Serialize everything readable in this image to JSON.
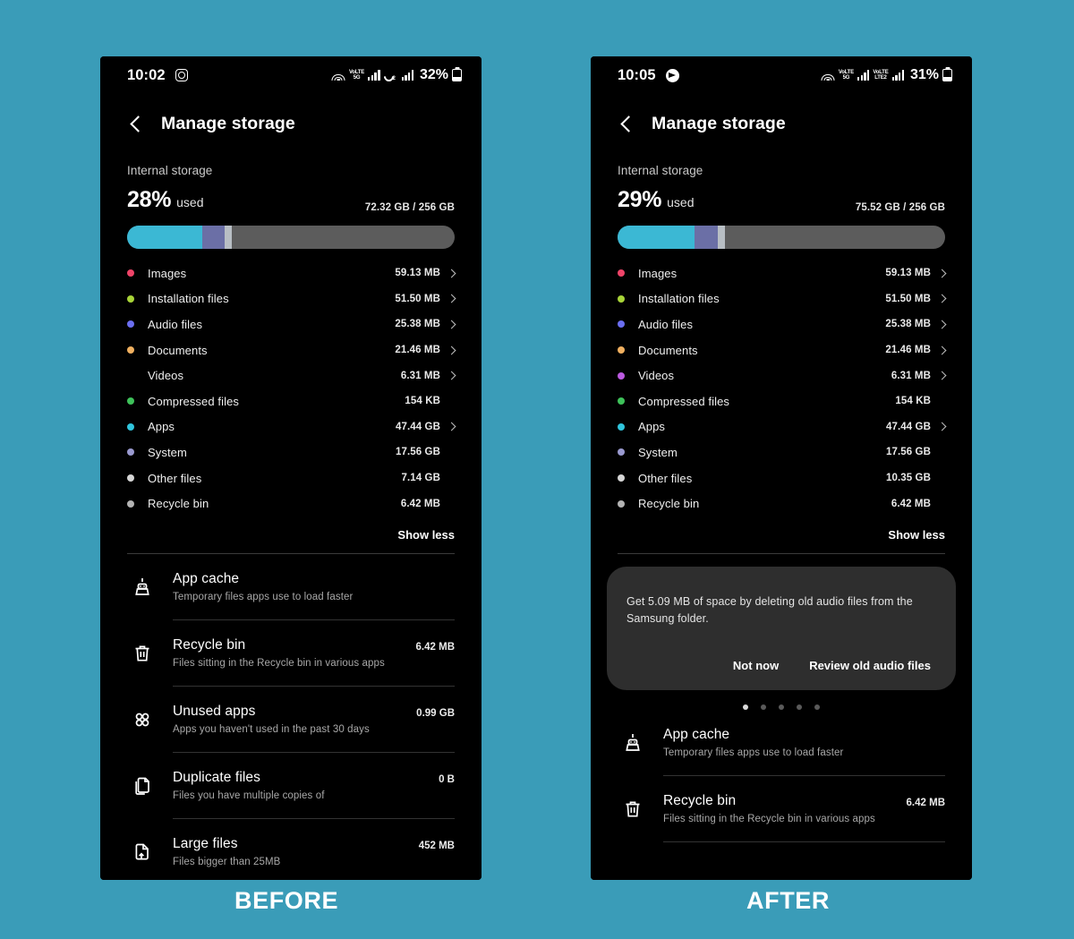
{
  "background_color": "#3a9cb8",
  "captions": {
    "before": "BEFORE",
    "after": "AFTER"
  },
  "before": {
    "status_bar": {
      "time": "10:02",
      "app_icon": "instagram-icon",
      "wifi_icon": "wifi-icon",
      "network1_label_top": "VoLTE",
      "network1_label_bottom": "5G",
      "signal1_icon": "signal-bars-icon",
      "call_icon": "call-forwarding-icon",
      "call_badge": "2",
      "signal2_icon": "signal-bars-icon",
      "battery_percent": "32%",
      "battery_icon": "battery-icon"
    },
    "app_bar": {
      "back_icon": "back-chevron-icon",
      "title": "Manage storage"
    },
    "summary": {
      "label": "Internal storage",
      "percent": "28%",
      "used_word": "used",
      "capacity": "72.32 GB / 256 GB",
      "bar_segments": [
        {
          "name": "apps",
          "color": "#3bb8d4",
          "width_pct": 23.0
        },
        {
          "name": "system",
          "color": "#6b6fa6",
          "width_pct": 6.8
        },
        {
          "name": "other",
          "color": "#b8bec4",
          "width_pct": 2.2
        }
      ],
      "track_color": "#5c5c5c"
    },
    "categories": [
      {
        "name": "Images",
        "size": "59.13 MB",
        "color": "#ef4468",
        "chevron": true
      },
      {
        "name": "Installation files",
        "size": "51.50 MB",
        "color": "#a8d438",
        "chevron": true
      },
      {
        "name": "Audio files",
        "size": "25.38 MB",
        "color": "#6b6ef0",
        "chevron": true
      },
      {
        "name": "Documents",
        "size": "21.46 MB",
        "color": "#f0b060",
        "chevron": true
      },
      {
        "name": "Videos",
        "size": "6.31 MB",
        "color": "#b martin",
        "chevron": true
      },
      {
        "name": "Compressed files",
        "size": "154 KB",
        "color": "#3ec25a",
        "chevron": false
      },
      {
        "name": "Apps",
        "size": "47.44 GB",
        "color": "#30c5dd",
        "chevron": true
      },
      {
        "name": "System",
        "size": "17.56 GB",
        "color": "#9a9ad0",
        "chevron": false
      },
      {
        "name": "Other files",
        "size": "7.14 GB",
        "color": "#d6d6d6",
        "chevron": false
      },
      {
        "name": "Recycle bin",
        "size": "6.42 MB",
        "color": "#b4b4b4",
        "chevron": false
      }
    ],
    "show_less": "Show less",
    "options": [
      {
        "icon": "broom-icon",
        "title": "App cache",
        "subtitle": "Temporary files apps use to load faster",
        "size": ""
      },
      {
        "icon": "trash-icon",
        "title": "Recycle bin",
        "subtitle": "Files sitting in the Recycle bin in various apps",
        "size": "6.42 MB"
      },
      {
        "icon": "four-dots-icon",
        "title": "Unused apps",
        "subtitle": "Apps you haven't used in the past 30 days",
        "size": "0.99 GB"
      },
      {
        "icon": "duplicate-files-icon",
        "title": "Duplicate files",
        "subtitle": "Files you have multiple copies of",
        "size": "0 B"
      },
      {
        "icon": "large-file-icon",
        "title": "Large files",
        "subtitle": "Files bigger than 25MB",
        "size": "452 MB"
      }
    ]
  },
  "after": {
    "status_bar": {
      "time": "10:05",
      "app_icon": "telegram-icon",
      "wifi_icon": "wifi-icon",
      "network1_label_top": "VoLTE",
      "network1_label_bottom": "5G",
      "signal1_icon": "signal-bars-icon",
      "network2_label_top": "VoLTE",
      "network2_label_bottom": "LTE2",
      "signal2_icon": "signal-bars-icon",
      "battery_percent": "31%",
      "battery_icon": "battery-icon"
    },
    "app_bar": {
      "back_icon": "back-chevron-icon",
      "title": "Manage storage"
    },
    "summary": {
      "label": "Internal storage",
      "percent": "29%",
      "used_word": "used",
      "capacity": "75.52 GB / 256 GB",
      "bar_segments": [
        {
          "name": "apps",
          "color": "#3bb8d4",
          "width_pct": 23.5
        },
        {
          "name": "system",
          "color": "#6b6fa6",
          "width_pct": 7.0
        },
        {
          "name": "other",
          "color": "#b8bec4",
          "width_pct": 2.4
        }
      ],
      "track_color": "#5c5c5c"
    },
    "categories": [
      {
        "name": "Images",
        "size": "59.13 MB",
        "color": "#ef4468",
        "chevron": true
      },
      {
        "name": "Installation files",
        "size": "51.50 MB",
        "color": "#a8d438",
        "chevron": true
      },
      {
        "name": "Audio files",
        "size": "25.38 MB",
        "color": "#6b6ef0",
        "chevron": true
      },
      {
        "name": "Documents",
        "size": "21.46 MB",
        "color": "#f0b060",
        "chevron": true
      },
      {
        "name": "Videos",
        "size": "6.31 MB",
        "color": "#bb5ae0",
        "chevron": true
      },
      {
        "name": "Compressed files",
        "size": "154 KB",
        "color": "#3ec25a",
        "chevron": false
      },
      {
        "name": "Apps",
        "size": "47.44 GB",
        "color": "#30c5dd",
        "chevron": true
      },
      {
        "name": "System",
        "size": "17.56 GB",
        "color": "#9a9ad0",
        "chevron": false
      },
      {
        "name": "Other files",
        "size": "10.35 GB",
        "color": "#d6d6d6",
        "chevron": false
      },
      {
        "name": "Recycle bin",
        "size": "6.42 MB",
        "color": "#b4b4b4",
        "chevron": false
      }
    ],
    "show_less": "Show less",
    "suggestion": {
      "text": "Get 5.09 MB of space by deleting old audio files from the Samsung folder.",
      "dismiss_label": "Not now",
      "action_label": "Review old audio files",
      "page_dots": 5,
      "active_dot": 0
    },
    "options": [
      {
        "icon": "broom-icon",
        "title": "App cache",
        "subtitle": "Temporary files apps use to load faster",
        "size": ""
      },
      {
        "icon": "trash-icon",
        "title": "Recycle bin",
        "subtitle": "Files sitting in the Recycle bin in various apps",
        "size": "6.42 MB"
      }
    ]
  }
}
